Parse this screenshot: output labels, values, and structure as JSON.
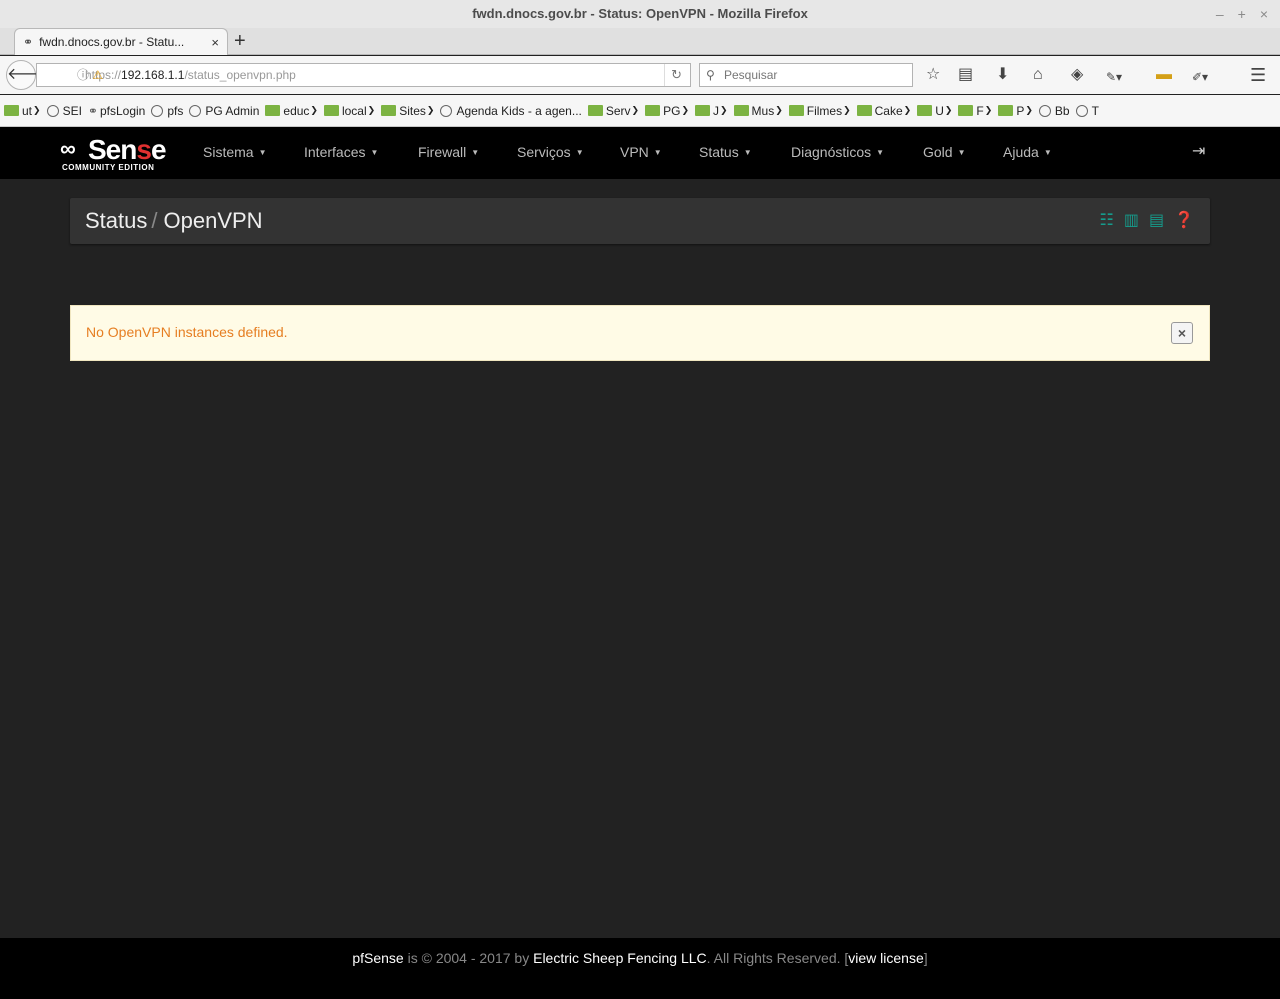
{
  "window": {
    "title": "fwdn.dnocs.gov.br - Status: OpenVPN - Mozilla Firefox",
    "controls": {
      "minimize": "–",
      "maximize": "+",
      "close": "×"
    }
  },
  "tab": {
    "title": "fwdn.dnocs.gov.br - Statu...",
    "close": "×",
    "new_tab": "+"
  },
  "url": {
    "scheme": "https://",
    "host": "192.168.1.1",
    "path": "/status_openvpn.php"
  },
  "search": {
    "placeholder": "Pesquisar"
  },
  "bookmarks": [
    {
      "label": "ut",
      "type": "folder"
    },
    {
      "label": "SEI",
      "type": "site"
    },
    {
      "label": "pfsLogin",
      "type": "pfsense"
    },
    {
      "label": "pfs",
      "type": "site"
    },
    {
      "label": "PG Admin",
      "type": "site"
    },
    {
      "label": "educ",
      "type": "folder"
    },
    {
      "label": "local",
      "type": "folder"
    },
    {
      "label": "Sites",
      "type": "folder"
    },
    {
      "label": "Agenda Kids - a agen...",
      "type": "site"
    },
    {
      "label": "Serv",
      "type": "folder"
    },
    {
      "label": "PG",
      "type": "folder"
    },
    {
      "label": "J",
      "type": "folder"
    },
    {
      "label": "Mus",
      "type": "folder"
    },
    {
      "label": "Filmes",
      "type": "folder"
    },
    {
      "label": "Cake",
      "type": "folder"
    },
    {
      "label": "U",
      "type": "folder"
    },
    {
      "label": "F",
      "type": "folder"
    },
    {
      "label": "P",
      "type": "folder"
    },
    {
      "label": "Bb",
      "type": "site"
    },
    {
      "label": "T",
      "type": "site"
    }
  ],
  "logo": {
    "word_start": "Sen",
    "word_highlight": "s",
    "word_end": "e",
    "edition": "COMMUNITY EDITION"
  },
  "menu": [
    {
      "label": "Sistema"
    },
    {
      "label": "Interfaces"
    },
    {
      "label": "Firewall"
    },
    {
      "label": "Serviços"
    },
    {
      "label": "VPN"
    },
    {
      "label": "Status"
    },
    {
      "label": "Diagnósticos"
    },
    {
      "label": "Gold"
    },
    {
      "label": "Ajuda"
    }
  ],
  "breadcrumb": {
    "parent": "Status",
    "separator": "/",
    "current": "OpenVPN"
  },
  "header_icons": [
    "sliders-icon",
    "bar-chart-icon",
    "list-icon",
    "help-icon"
  ],
  "alert": {
    "message": "No OpenVPN instances defined.",
    "close": "×"
  },
  "footer": {
    "product": "pfSense",
    "copyright": " is © 2004 - 2017 by ",
    "company": "Electric Sheep Fencing LLC",
    "rights": ". All Rights Reserved. [",
    "license": "view license",
    "end": "]"
  },
  "colors": {
    "accent": "#159c8c",
    "alert_text": "#e67e22",
    "alert_bg": "#fffbe6",
    "logo_red": "#e03030"
  }
}
